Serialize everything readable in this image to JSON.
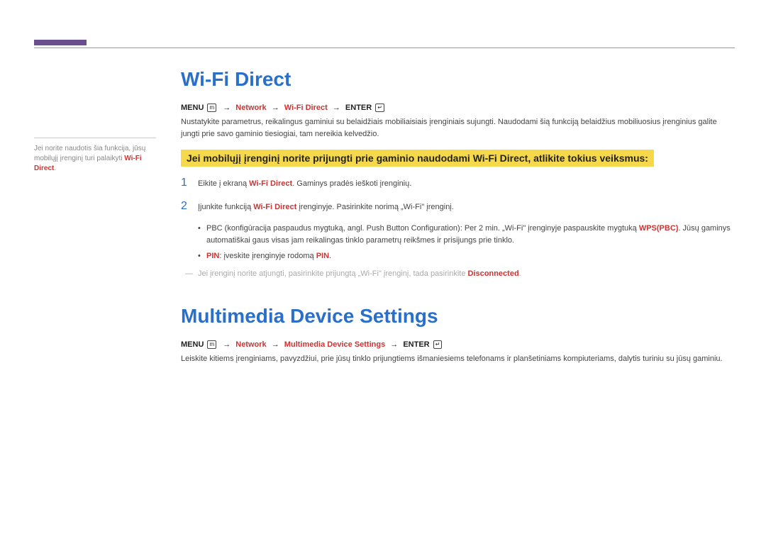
{
  "sidebar": {
    "text_a": "Jei norite naudotis šia funkcija, jūsų mobilųjį įrenginį turi palaikyti ",
    "text_b": "Wi-Fi Direct",
    "text_c": "."
  },
  "section1": {
    "title": "Wi-Fi Direct",
    "nav": {
      "menu": "MENU",
      "arrow": "→",
      "network": "Network",
      "item": "Wi-Fi Direct",
      "enter": "ENTER"
    },
    "intro": "Nustatykite parametrus, reikalingus gaminiui su belaidžiais mobiliaisiais įrenginiais sujungti. Naudodami šią funkciją belaidžius mobiliuosius įrenginius galite jungti prie savo gaminio tiesiogiai, tam nereikia kelvedžio.",
    "highlight": "Jei mobilųjį įrenginį norite prijungti prie gaminio naudodami Wi-Fi Direct, atlikite tokius veiksmus:",
    "step1": {
      "num": "1",
      "a": "Eikite į ekraną ",
      "b": "Wi-Fi Direct",
      "c": ". Gaminys pradės ieškoti įrenginių."
    },
    "step2": {
      "num": "2",
      "a": "Įjunkite funkciją ",
      "b": "Wi-Fi Direct",
      "c": " įrenginyje. Pasirinkite norimą „Wi-Fi\" įrenginį."
    },
    "bullet1": {
      "a": "PBC (konfigūracija paspaudus mygtuką, angl. Push Button Configuration): Per 2 min. „Wi-Fi\" įrenginyje paspauskite mygtuką ",
      "b": "WPS(PBC)",
      "c": ". Jūsų gaminys automatiškai gaus visas jam reikalingas tinklo parametrų reikšmes ir prisijungs prie tinklo."
    },
    "bullet2": {
      "a": "PIN",
      "b": ": įveskite įrenginyje rodomą ",
      "c": "PIN",
      "d": "."
    },
    "note": {
      "a": "Jei įrenginį norite atjungti, pasirinkite prijungtą „Wi-Fi\" įrenginį, tada pasirinkite ",
      "b": "Disconnected",
      "c": "."
    }
  },
  "section2": {
    "title": "Multimedia Device Settings",
    "nav": {
      "menu": "MENU",
      "arrow": "→",
      "network": "Network",
      "item": "Multimedia Device Settings",
      "enter": "ENTER"
    },
    "para": "Leiskite kitiems įrenginiams, pavyzdžiui, prie jūsų tinklo prijungtiems išmaniesiems telefonams ir planšetiniams kompiuteriams, dalytis turiniu su jūsų gaminiu."
  },
  "icons": {
    "menu": "m",
    "enter": "↵"
  }
}
